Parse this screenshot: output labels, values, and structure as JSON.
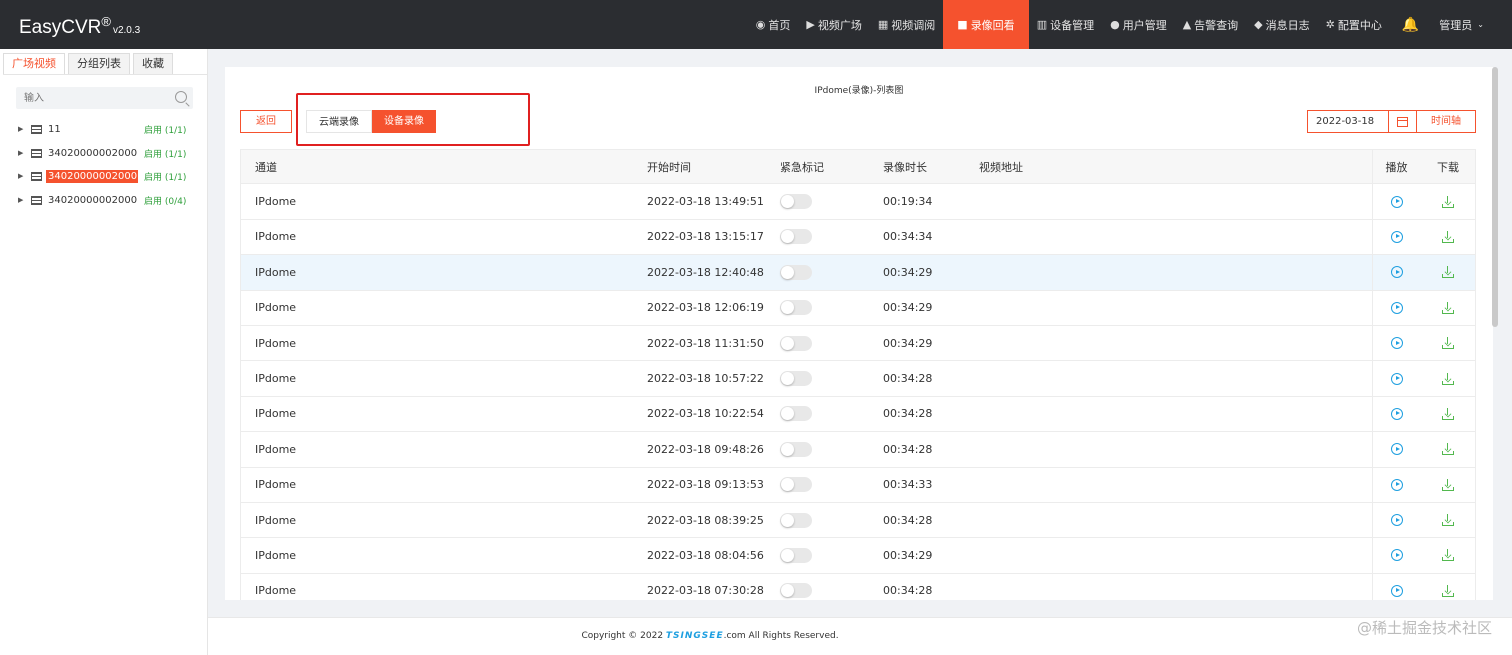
{
  "app": {
    "name": "EasyCVR",
    "reg": "®",
    "version": "v2.0.3"
  },
  "nav": {
    "items": [
      {
        "icon": "dashboard-icon",
        "label": "首页"
      },
      {
        "icon": "play-circle-icon",
        "label": "视频广场"
      },
      {
        "icon": "grid-icon",
        "label": "视频调阅"
      },
      {
        "icon": "video-camera-icon",
        "label": "录像回看",
        "active": true
      },
      {
        "icon": "device-icon",
        "label": "设备管理"
      },
      {
        "icon": "user-icon",
        "label": "用户管理"
      },
      {
        "icon": "alarm-icon",
        "label": "告警查询"
      },
      {
        "icon": "bell-icon",
        "label": "消息日志"
      },
      {
        "icon": "gear-icon",
        "label": "配置中心"
      }
    ],
    "user_label": "管理员",
    "accent": "#f5522e"
  },
  "sidebar": {
    "tabs": [
      "广场视频",
      "分组列表",
      "收藏"
    ],
    "search_placeholder": "输入",
    "tree": [
      {
        "name": "11",
        "status": "启用",
        "count": "(1/1)",
        "selected": false
      },
      {
        "name": "34020000002000...",
        "status": "启用",
        "count": "(1/1)",
        "selected": false
      },
      {
        "name": "34020000002000...",
        "status": "启用",
        "count": "(1/1)",
        "selected": true
      },
      {
        "name": "34020000002000...",
        "status": "启用",
        "count": "(0/4)",
        "selected": false
      }
    ]
  },
  "main": {
    "title": "IPdome(录像)-列表图",
    "back_label": "返回",
    "segment": {
      "cloud": "云端录像",
      "device": "设备录像"
    },
    "date": "2022-03-18",
    "timeline_label": "时间轴",
    "columns": {
      "channel": "通道",
      "start": "开始时间",
      "flag": "紧急标记",
      "duration": "录像时长",
      "url": "视频地址",
      "play": "播放",
      "download": "下载"
    },
    "rows": [
      {
        "channel": "IPdome",
        "start": "2022-03-18 13:49:51",
        "duration": "00:19:34",
        "url": ""
      },
      {
        "channel": "IPdome",
        "start": "2022-03-18 13:15:17",
        "duration": "00:34:34",
        "url": ""
      },
      {
        "channel": "IPdome",
        "start": "2022-03-18 12:40:48",
        "duration": "00:34:29",
        "url": ""
      },
      {
        "channel": "IPdome",
        "start": "2022-03-18 12:06:19",
        "duration": "00:34:29",
        "url": ""
      },
      {
        "channel": "IPdome",
        "start": "2022-03-18 11:31:50",
        "duration": "00:34:29",
        "url": ""
      },
      {
        "channel": "IPdome",
        "start": "2022-03-18 10:57:22",
        "duration": "00:34:28",
        "url": ""
      },
      {
        "channel": "IPdome",
        "start": "2022-03-18 10:22:54",
        "duration": "00:34:28",
        "url": ""
      },
      {
        "channel": "IPdome",
        "start": "2022-03-18 09:48:26",
        "duration": "00:34:28",
        "url": ""
      },
      {
        "channel": "IPdome",
        "start": "2022-03-18 09:13:53",
        "duration": "00:34:33",
        "url": ""
      },
      {
        "channel": "IPdome",
        "start": "2022-03-18 08:39:25",
        "duration": "00:34:28",
        "url": ""
      },
      {
        "channel": "IPdome",
        "start": "2022-03-18 08:04:56",
        "duration": "00:34:29",
        "url": ""
      },
      {
        "channel": "IPdome",
        "start": "2022-03-18 07:30:28",
        "duration": "00:34:28",
        "url": ""
      }
    ]
  },
  "footer": {
    "copyright_pre": "Copyright © 2022",
    "brand": "TSINGSEE",
    "copyright_post": ".com All Rights Reserved."
  },
  "watermark": "@稀土掘金技术社区"
}
